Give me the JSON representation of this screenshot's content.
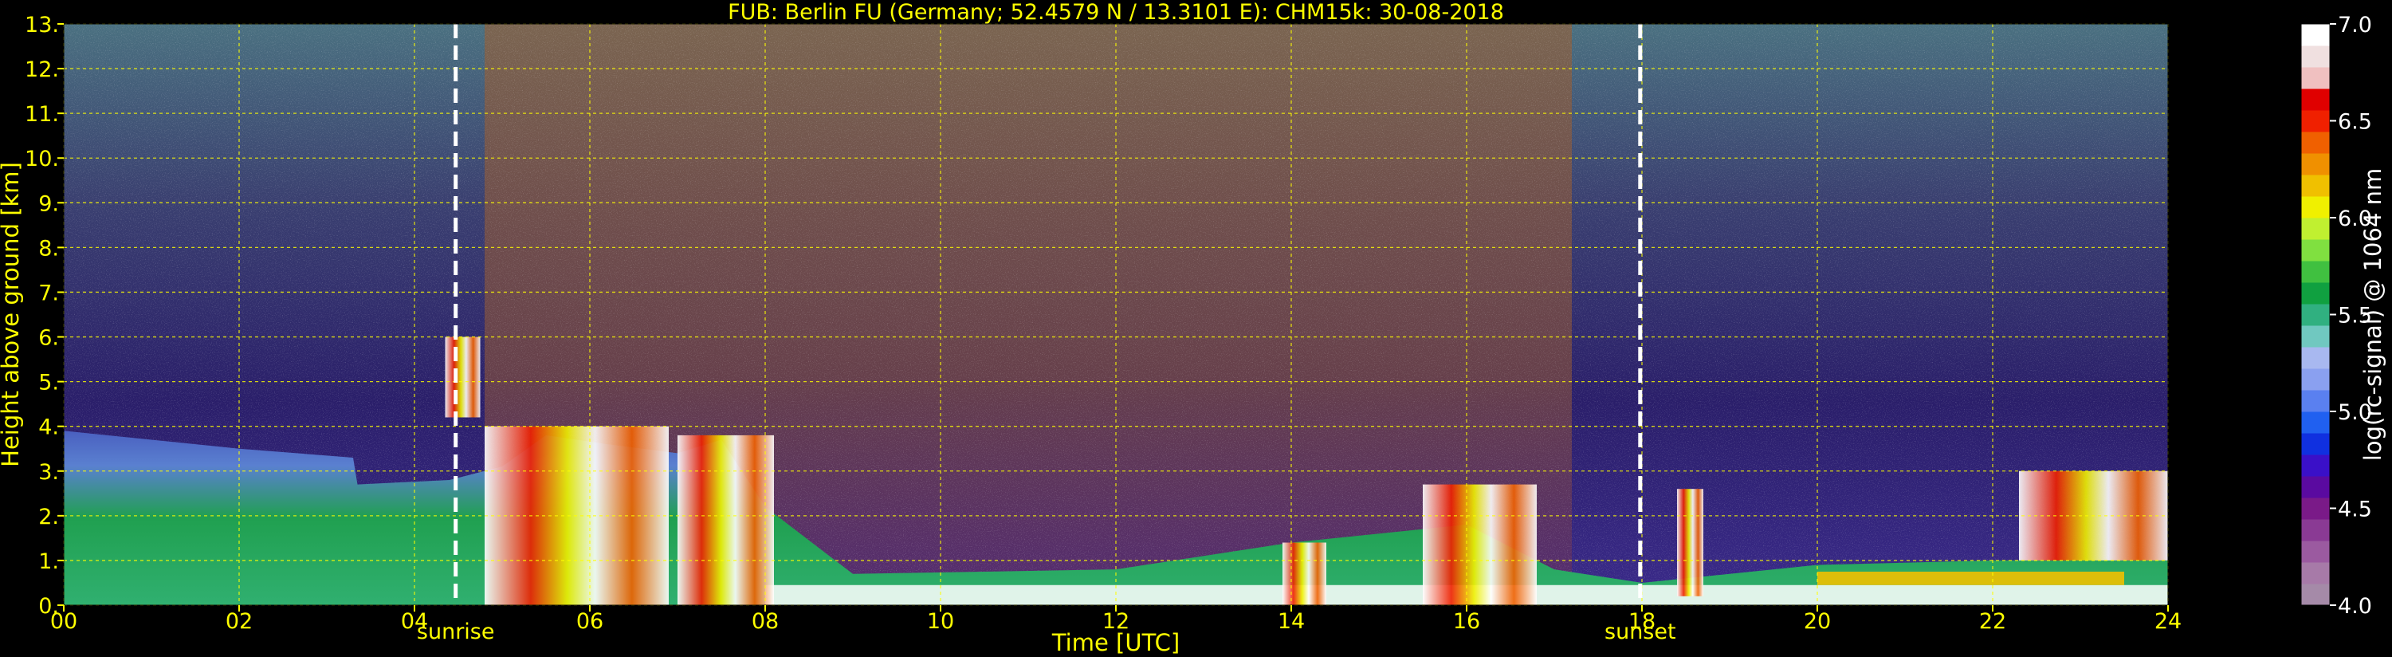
{
  "chart_data": {
    "type": "heatmap",
    "title": "FUB: Berlin FU (Germany; 52.4579 N / 13.3101 E):    CHM15k: 30-08-2018",
    "xlabel": "Time [UTC]",
    "ylabel": "Height above ground [km]",
    "xlim": [
      0,
      24
    ],
    "ylim": [
      0,
      13
    ],
    "x_ticks": [
      {
        "value": 0,
        "label": "00"
      },
      {
        "value": 2,
        "label": "02"
      },
      {
        "value": 4,
        "label": "04"
      },
      {
        "value": 6,
        "label": "06"
      },
      {
        "value": 8,
        "label": "08"
      },
      {
        "value": 10,
        "label": "10"
      },
      {
        "value": 12,
        "label": "12"
      },
      {
        "value": 14,
        "label": "14"
      },
      {
        "value": 16,
        "label": "16"
      },
      {
        "value": 18,
        "label": "18"
      },
      {
        "value": 20,
        "label": "20"
      },
      {
        "value": 22,
        "label": "22"
      },
      {
        "value": 24,
        "label": "24"
      }
    ],
    "y_ticks": [
      {
        "value": 0,
        "label": "0."
      },
      {
        "value": 1,
        "label": "1."
      },
      {
        "value": 2,
        "label": "2."
      },
      {
        "value": 3,
        "label": "3."
      },
      {
        "value": 4,
        "label": "4."
      },
      {
        "value": 5,
        "label": "5."
      },
      {
        "value": 6,
        "label": "6."
      },
      {
        "value": 7,
        "label": "7."
      },
      {
        "value": 8,
        "label": "8."
      },
      {
        "value": 9,
        "label": "9."
      },
      {
        "value": 10,
        "label": "10."
      },
      {
        "value": 11,
        "label": "11."
      },
      {
        "value": 12,
        "label": "12."
      },
      {
        "value": 13,
        "label": "13."
      }
    ],
    "grid": true,
    "markers": [
      {
        "name": "sunrise",
        "label": "sunrise",
        "x": 4.47
      },
      {
        "name": "sunset",
        "label": "sunset",
        "x": 17.98
      }
    ],
    "colorbar": {
      "label": "log(rc-signal) @ 1064 nm",
      "range": [
        4.0,
        7.0
      ],
      "ticks": [
        {
          "value": 4.0,
          "label": "4.0"
        },
        {
          "value": 4.5,
          "label": "4.5"
        },
        {
          "value": 5.0,
          "label": "5.0"
        },
        {
          "value": 5.5,
          "label": "5.5"
        },
        {
          "value": 6.0,
          "label": "6.0"
        },
        {
          "value": 6.5,
          "label": "6.5"
        },
        {
          "value": 7.0,
          "label": "7.0"
        }
      ],
      "colors": [
        "#a58aa8",
        "#a77aa8",
        "#9b5aa0",
        "#8a3a94",
        "#7a1a88",
        "#5a0aa0",
        "#3a10c8",
        "#1030e0",
        "#2060f0",
        "#5a80f0",
        "#8aa0f0",
        "#a8b8f0",
        "#70c8c0",
        "#30b080",
        "#10a040",
        "#40c040",
        "#80e040",
        "#c0f030",
        "#f0f000",
        "#f0c000",
        "#f09000",
        "#f06000",
        "#f02000",
        "#e00000",
        "#f0c0c0",
        "#f0e0e0",
        "#ffffff"
      ]
    },
    "aerosol_layer": [
      {
        "x": 0.0,
        "top": 3.9,
        "bottom": 0.0
      },
      {
        "x": 1.0,
        "top": 3.7,
        "bottom": 0.0
      },
      {
        "x": 2.0,
        "top": 3.5,
        "bottom": 0.0
      },
      {
        "x": 3.3,
        "top": 3.3,
        "bottom": 0.0
      },
      {
        "x": 3.35,
        "top": 2.7,
        "bottom": 0.0
      },
      {
        "x": 4.4,
        "top": 2.8,
        "bottom": 0.0
      },
      {
        "x": 5.0,
        "top": 3.1,
        "bottom": 0.0
      },
      {
        "x": 5.5,
        "top": 3.8,
        "bottom": 0.0
      },
      {
        "x": 6.2,
        "top": 3.6,
        "bottom": 0.0
      },
      {
        "x": 7.0,
        "top": 3.4,
        "bottom": 0.0
      },
      {
        "x": 7.5,
        "top": 3.7,
        "bottom": 0.0
      },
      {
        "x": 8.0,
        "top": 2.2,
        "bottom": 0.0
      },
      {
        "x": 9.0,
        "top": 0.7,
        "bottom": 0.0
      },
      {
        "x": 12.0,
        "top": 0.8,
        "bottom": 0.0
      },
      {
        "x": 14.0,
        "top": 1.4,
        "bottom": 0.0
      },
      {
        "x": 16.0,
        "top": 1.8,
        "bottom": 0.0
      },
      {
        "x": 17.0,
        "top": 0.8,
        "bottom": 0.0
      },
      {
        "x": 18.0,
        "top": 0.5,
        "bottom": 0.0
      },
      {
        "x": 20.0,
        "top": 0.9,
        "bottom": 0.0
      },
      {
        "x": 22.0,
        "top": 1.0,
        "bottom": 0.0
      },
      {
        "x": 24.0,
        "top": 1.0,
        "bottom": 0.0
      }
    ],
    "clouds": [
      {
        "x_start": 4.35,
        "x_end": 4.75,
        "bottom": 4.2,
        "top": 6.0
      },
      {
        "x_start": 4.8,
        "x_end": 6.9,
        "bottom": 0.0,
        "top": 4.0
      },
      {
        "x_start": 7.0,
        "x_end": 8.1,
        "bottom": 0.0,
        "top": 3.8
      },
      {
        "x_start": 13.9,
        "x_end": 14.4,
        "bottom": 0.0,
        "top": 1.4
      },
      {
        "x_start": 15.5,
        "x_end": 16.8,
        "bottom": 0.0,
        "top": 2.7
      },
      {
        "x_start": 18.4,
        "x_end": 18.7,
        "bottom": 0.2,
        "top": 2.6
      },
      {
        "x_start": 22.3,
        "x_end": 24.0,
        "bottom": 1.0,
        "top": 3.0
      }
    ]
  }
}
